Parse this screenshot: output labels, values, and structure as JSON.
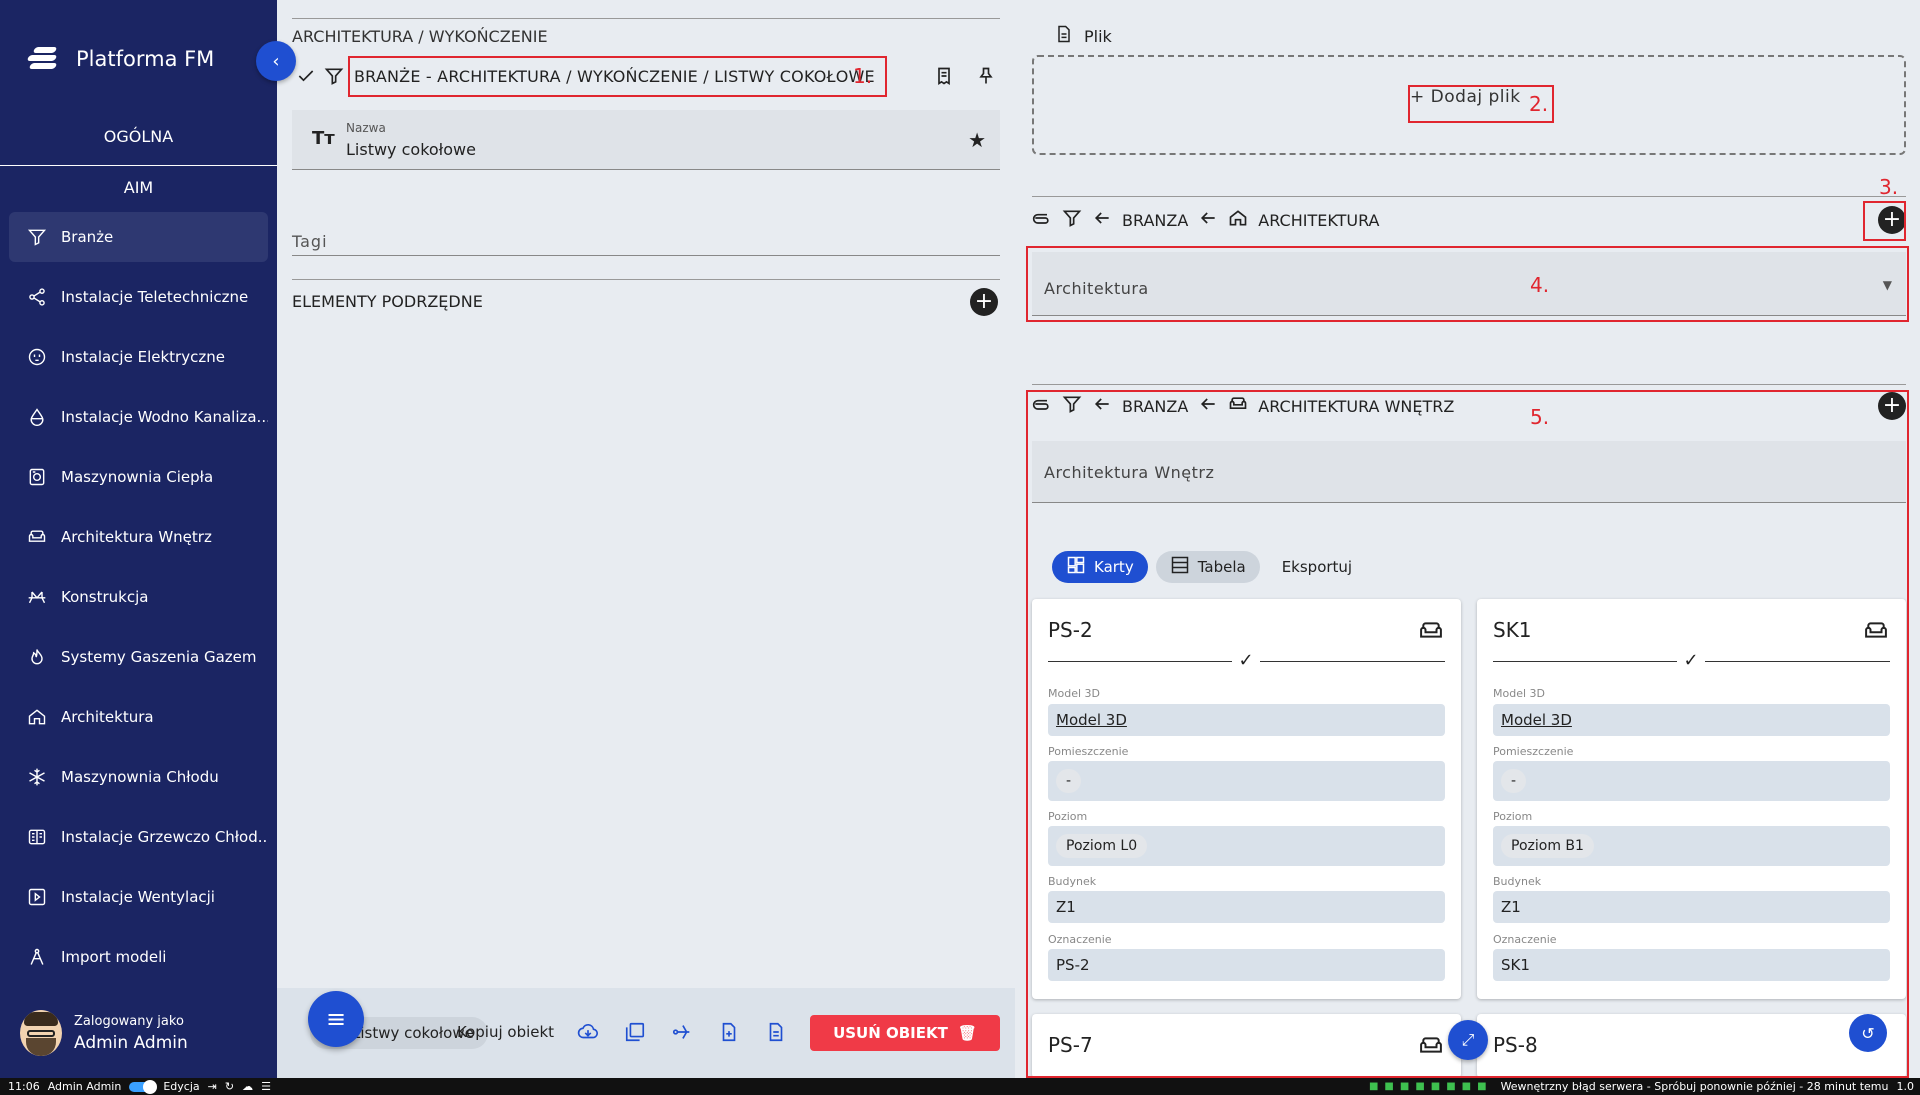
{
  "app": {
    "name": "Platforma FM"
  },
  "sidebar": {
    "section_general": "OGÓLNA",
    "section_aim": "AIM",
    "items": [
      {
        "label": "Branże",
        "icon": "filter-icon",
        "active": true
      },
      {
        "label": "Instalacje Teletechniczne",
        "icon": "share-icon"
      },
      {
        "label": "Instalacje Elektryczne",
        "icon": "socket-icon"
      },
      {
        "label": "Instalacje Wodno Kanaliza...",
        "icon": "drop-icon"
      },
      {
        "label": "Maszynownia Ciepła",
        "icon": "boiler-icon"
      },
      {
        "label": "Architektura Wnętrz",
        "icon": "sofa-icon"
      },
      {
        "label": "Konstrukcja",
        "icon": "bridge-icon"
      },
      {
        "label": "Systemy Gaszenia Gazem",
        "icon": "fire-icon"
      },
      {
        "label": "Architektura",
        "icon": "home-icon"
      },
      {
        "label": "Maszynownia Chłodu",
        "icon": "snowflake-icon"
      },
      {
        "label": "Instalacje Grzewczo Chłod...",
        "icon": "panel-icon"
      },
      {
        "label": "Instalacje Wentylacji",
        "icon": "play-box-icon"
      },
      {
        "label": "Import modeli",
        "icon": "compass-icon"
      }
    ],
    "user": {
      "logged_as": "Zalogowany jako",
      "name": "Admin Admin"
    }
  },
  "main": {
    "path_title": "ARCHITEKTURA / WYKOŃCZENIE",
    "breadcrumb_full": "BRANŻE - ARCHITEKTURA / WYKOŃCZENIE / LISTWY COKOŁOWE",
    "name_field": {
      "label": "Nazwa",
      "value": "Listwy cokołowe"
    },
    "tags_label": "Tagi",
    "children_label": "ELEMENTY PODRZĘDNE"
  },
  "toolbar": {
    "name_chip": "Listwy cokołowe",
    "copy_label": "Kopiuj obiekt",
    "delete_label": "USUŃ OBIEKT"
  },
  "files": {
    "label": "Plik",
    "add_label": "Dodaj plik"
  },
  "relation1": {
    "type": "BRANZA",
    "target": "ARCHITEKTURA",
    "select_value": "Architektura"
  },
  "relation2": {
    "type": "BRANZA",
    "target": "ARCHITEKTURA WNĘTRZ",
    "select_value": "Architektura Wnętrz",
    "tabs": {
      "cards": "Karty",
      "table": "Tabela",
      "export": "Eksportuj"
    },
    "cards": [
      {
        "title": "PS-2",
        "fields": [
          {
            "label": "Model 3D",
            "value": "Model 3D"
          },
          {
            "label": "Pomieszczenie",
            "value": "-"
          },
          {
            "label": "Poziom",
            "value": "Poziom L0"
          },
          {
            "label": "Budynek",
            "value": "Z1"
          },
          {
            "label": "Oznaczenie",
            "value": "PS-2"
          }
        ]
      },
      {
        "title": "SK1",
        "fields": [
          {
            "label": "Model 3D",
            "value": "Model 3D"
          },
          {
            "label": "Pomieszczenie",
            "value": "-"
          },
          {
            "label": "Poziom",
            "value": "Poziom B1"
          },
          {
            "label": "Budynek",
            "value": "Z1"
          },
          {
            "label": "Oznaczenie",
            "value": "SK1"
          }
        ]
      },
      {
        "title": "PS-7"
      },
      {
        "title": "PS-8"
      }
    ]
  },
  "annotations": [
    "1.",
    "2.",
    "3.",
    "4.",
    "5."
  ],
  "taskbar": {
    "time": "11:06",
    "user": "Admin Admin",
    "mode": "Edycja",
    "status": "Wewnętrzny błąd serwera - Spróbuj ponownie później - 28 minut temu",
    "version": "1.0"
  },
  "colors": {
    "sidebar": "#1b2563",
    "accent": "#1f4fd1",
    "danger": "#f03a47",
    "annotation": "#e0262f"
  }
}
